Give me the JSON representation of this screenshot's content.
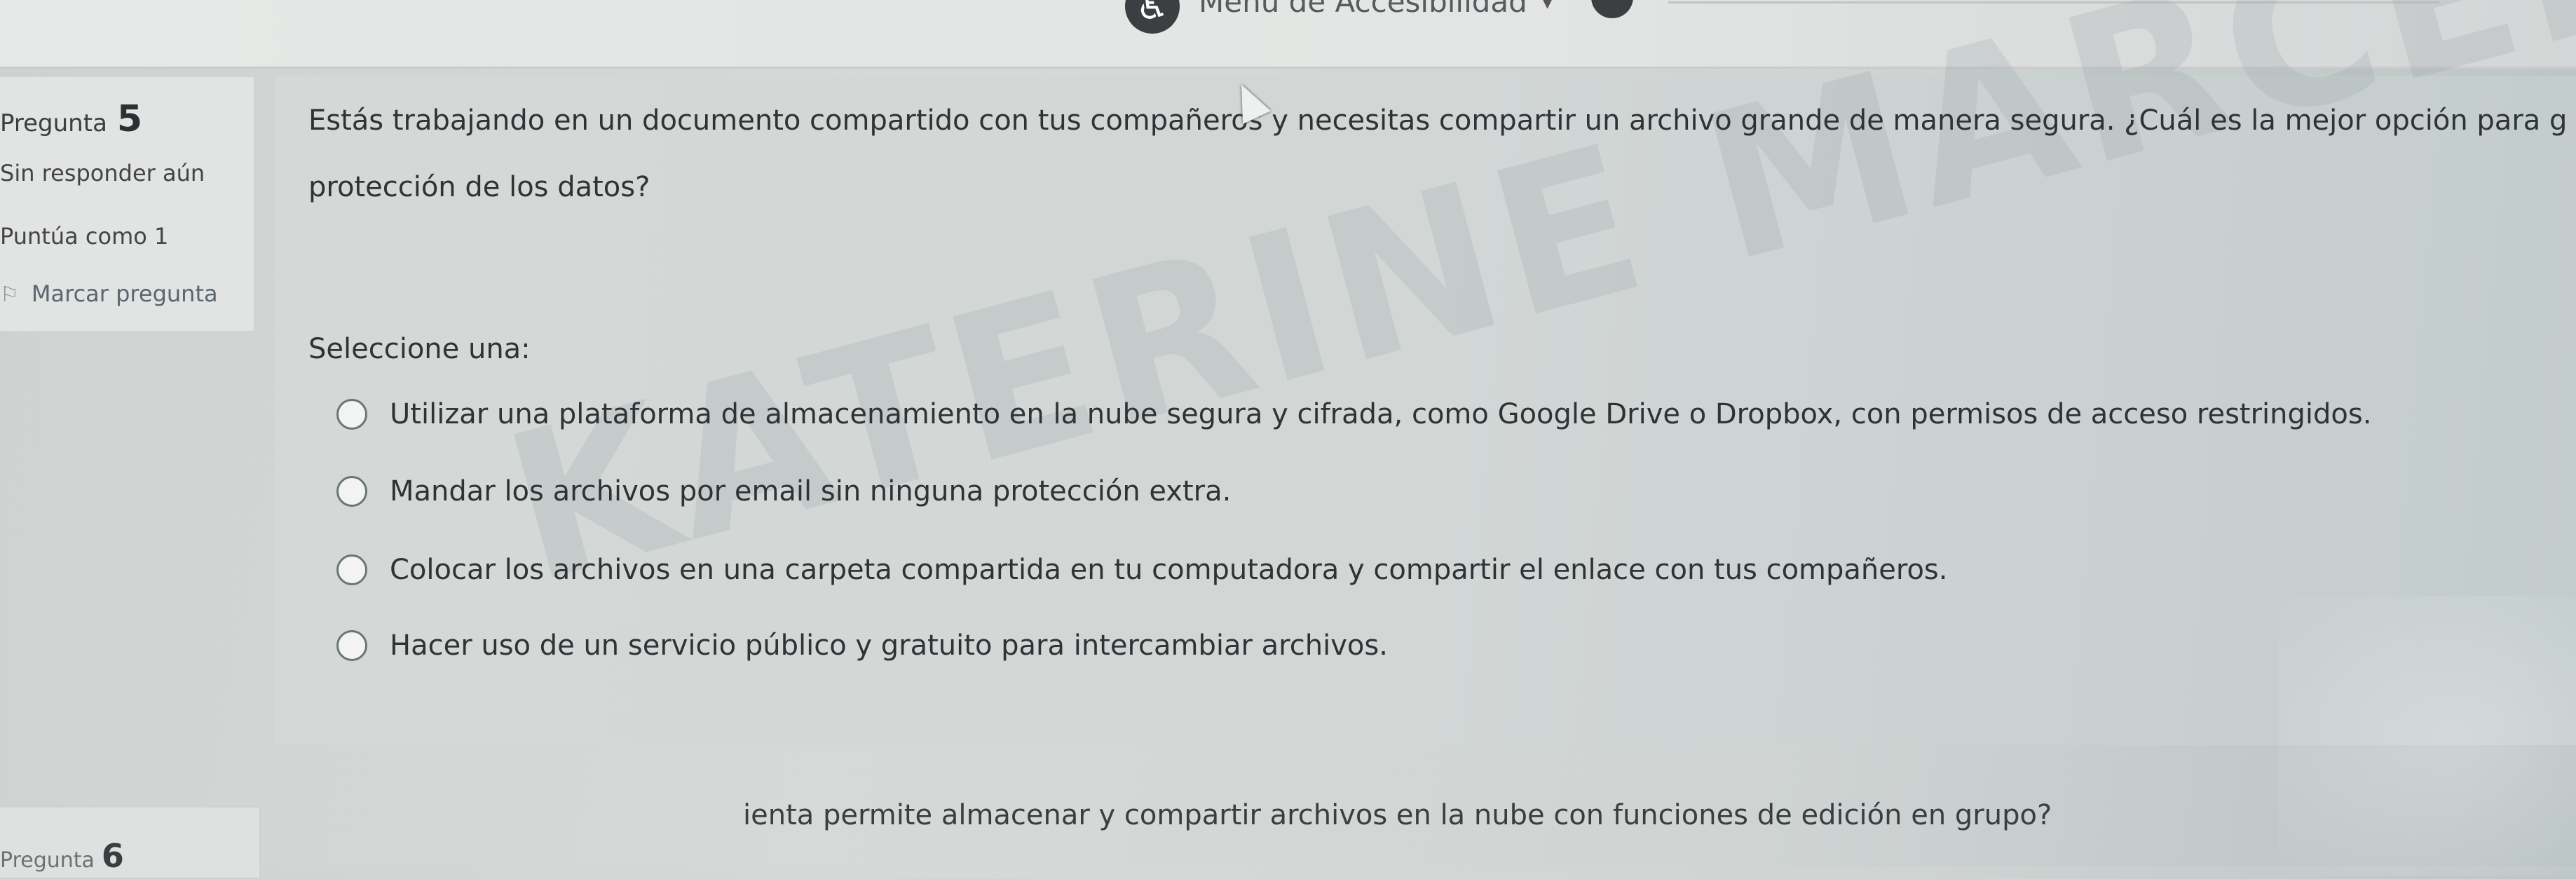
{
  "top_menu": {
    "accessibility_label": "Menú de Accesibilidad"
  },
  "question": {
    "label": "Pregunta",
    "number": "5",
    "status": "Sin responder aún",
    "score": "Puntúa como 1",
    "flag_label": "Marcar pregunta",
    "text_line1": "Estás trabajando en un documento compartido con tus compañeros y necesitas compartir un archivo grande de manera segura. ¿Cuál es la mejor opción para g",
    "text_line2": "protección de los datos?",
    "prompt": "Seleccione una:",
    "options": [
      "Utilizar una plataforma de almacenamiento en la nube segura y cifrada, como Google Drive o Dropbox, con permisos de acceso restringidos.",
      "Mandar los archivos por email sin ninguna protección extra.",
      "Colocar los archivos en una carpeta compartida en tu computadora y compartir el enlace con tus compañeros.",
      "Hacer uso de un servicio público y gratuito para intercambiar archivos."
    ]
  },
  "watermark": "KATERINE MARCELA CATANEDA",
  "next_question": {
    "label": "Pregunta",
    "number": "6",
    "text": "ienta permite almacenar y compartir archivos en la nube con funciones de edición en grupo?"
  }
}
